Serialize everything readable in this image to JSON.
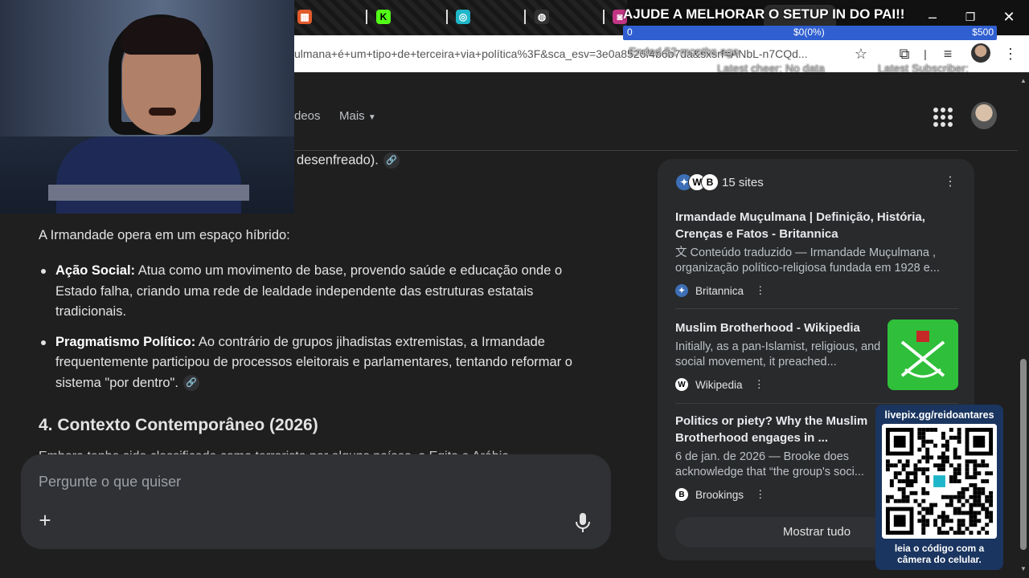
{
  "browser": {
    "url_text": "ulmana+é+um+tipo+de+terceira+via+política%3F&sca_esv=3e0a8526f4b6b7da&sxsrf=ANbL-n7CQd...",
    "window_controls": {
      "minimize": "–",
      "maximize": "❐",
      "close": "✕"
    }
  },
  "overlay": {
    "donation_title": "AJUDE A MELHORAR O SETUP IN DO PAI!!",
    "donation_min": "0",
    "donation_current": "$0(0%)",
    "donation_max": "$500",
    "donation_progress": 0,
    "ended_text": "Ended 52 months ago",
    "latest_cheer": "Latest cheer: No data",
    "latest_subscriber": "Latest Subscriber:",
    "qr_url": "livepix.gg/reidoantares",
    "qr_caption_line1": "leia o código com a",
    "qr_caption_line2": "câmera do celular."
  },
  "search": {
    "tabs": [
      "deos",
      "Mais"
    ]
  },
  "answer": {
    "prev_line": "desenfreado).",
    "intro": "A Irmandade opera em um espaço híbrido:",
    "bullets": [
      {
        "bold": "Ação Social:",
        "text": " Atua como um movimento de base, provendo saúde e educação onde o Estado falha, criando uma rede de lealdade independente das estruturas estatais tradicionais."
      },
      {
        "bold": "Pragmatismo Político:",
        "text": " Ao contrário de grupos jihadistas extremistas, a Irmandade frequentemente participou de processos eleitorais e parlamentares, tentando reformar o sistema \"por dentro\"."
      }
    ],
    "section_heading": "4. Contexto Contemporâneo (2026)",
    "cut_text": "Embora tenha sido classificada como terrorista por alguns países, o Egito e Arábia"
  },
  "prompt": {
    "placeholder": "Pergunte o que quiser"
  },
  "sources": {
    "count_label": "15 sites",
    "items": [
      {
        "title": "Irmandade Muçulmana | Definição, História, Crenças e Fatos - Britannica",
        "snippet": "Conteúdo traduzido — Irmandade Muçulmana , organização político-religiosa fundada em 1928 e...",
        "site": "Britannica"
      },
      {
        "title": "Muslim Brotherhood - Wikipedia",
        "snippet": "Initially, as a pan-Islamist, religious, and social movement, it preached...",
        "site": "Wikipedia"
      },
      {
        "title": "Politics or piety? Why the Muslim Brotherhood engages in ...",
        "snippet": "6 de jan. de 2026 — Brooke does acknowledge that “the group's soci...",
        "site": "Brookings"
      }
    ],
    "show_all": "Mostrar tudo"
  },
  "colors": {
    "accent_green": "#2fbf3a",
    "panel_blue": "#1a3560",
    "donation_blue": "#2f5fd0"
  }
}
